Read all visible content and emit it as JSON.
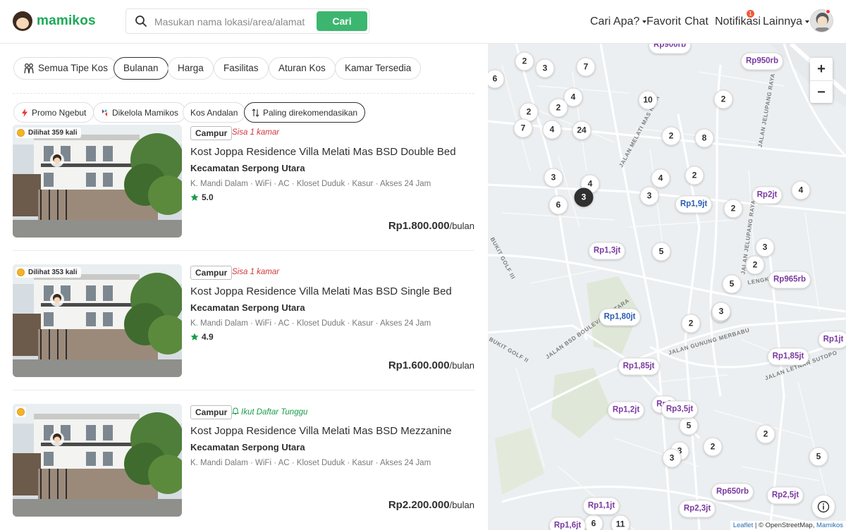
{
  "header": {
    "logo_text": "mamikos",
    "search_placeholder": "Masukan nama lokasi/area/alamat",
    "search_button": "Cari",
    "nav": [
      "Cari Apa?",
      "Favorit",
      "Chat",
      "Notifikasi",
      "Lainnya"
    ],
    "notification_count": "1"
  },
  "filters": {
    "primary": [
      "Semua Tipe Kos",
      "Bulanan",
      "Harga",
      "Fasilitas",
      "Aturan Kos",
      "Kamar Tersedia"
    ],
    "active": "Bulanan",
    "secondary": [
      "Promo Ngebut",
      "Dikelola Mamikos",
      "Kos Andalan",
      "Paling direkomendasikan"
    ]
  },
  "listings": [
    {
      "views": "Dilihat 359 kali",
      "type": "Campur",
      "availability": "Sisa 1 kamar",
      "title": "Kost Joppa Residence Villa Melati Mas BSD Double Bed",
      "area": "Kecamatan Serpong Utara",
      "facilities": "K. Mandi Dalam · WiFi · AC · Kloset Duduk · Kasur · Akses 24 Jam",
      "rating": "5.0",
      "price": "Rp1.800.000",
      "period": "/bulan"
    },
    {
      "views": "Dilihat 353 kali",
      "type": "Campur",
      "availability": "Sisa 1 kamar",
      "title": "Kost Joppa Residence Villa Melati Mas BSD Single Bed",
      "area": "Kecamatan Serpong Utara",
      "facilities": "K. Mandi Dalam · WiFi · AC · Kloset Duduk · Kasur · Akses 24 Jam",
      "rating": "4.9",
      "price": "Rp1.600.000",
      "period": "/bulan"
    },
    {
      "views": "",
      "type": "Campur",
      "availability": "Ikut Daftar Tunggu",
      "title": "Kost Joppa Residence Villa Melati Mas BSD Mezzanine",
      "area": "Kecamatan Serpong Utara",
      "facilities": "K. Mandi Dalam · WiFi · AC · Kloset Duduk · Kasur · Akses 24 Jam",
      "rating": "",
      "price": "Rp2.200.000",
      "period": "/bulan"
    }
  ],
  "map": {
    "count_markers": [
      "2",
      "3",
      "7",
      "6",
      "4",
      "2",
      "2",
      "7",
      "4",
      "24",
      "10",
      "2",
      "8",
      "2",
      "3",
      "4",
      "3",
      "6",
      "3",
      "4",
      "2",
      "2",
      "4",
      "5",
      "3",
      "2",
      "5",
      "2",
      "2",
      "3",
      "5",
      "3",
      "3",
      "2",
      "2",
      "6",
      "11",
      "5"
    ],
    "price_markers": [
      "Rp900rb",
      "Rp950rb",
      "Rp1,9jt",
      "Rp2jt",
      "Rp1,3jt",
      "Rp965rb",
      "Rp1,80jt",
      "Rp1jt",
      "Rp1,85jt",
      "Rp1,85jt",
      "Rp1,2jt",
      "Rp2",
      "Rp3,5jt",
      "Rp650rb",
      "Rp2,5jt",
      "Rp1,1jt",
      "Rp2,3jt",
      "Rp1,6jt"
    ],
    "streets": [
      "JALAN MELATI MAS RAYA",
      "JALAN JELUPANG RAYA",
      "JALAN BSD BOULEVARD UTARA",
      "JALAN GUNUNG MERBABU",
      "JALAN LETNAN SUTOPO",
      "LENGKONG RAYA",
      "BUKIT GOLF III",
      "BUKIT GOLF II",
      "JALAN JELUPANG RAYA"
    ],
    "zoom_in": "+",
    "zoom_out": "−",
    "attribution_leaflet": "Leaflet",
    "attribution_osm": "© OpenStreetMap",
    "attribution_mamikos": "Mamikos"
  },
  "colors": {
    "brand": "#1baa56",
    "price_marker": "#7a3aa0",
    "price_marker_alt": "#2a5db0"
  }
}
